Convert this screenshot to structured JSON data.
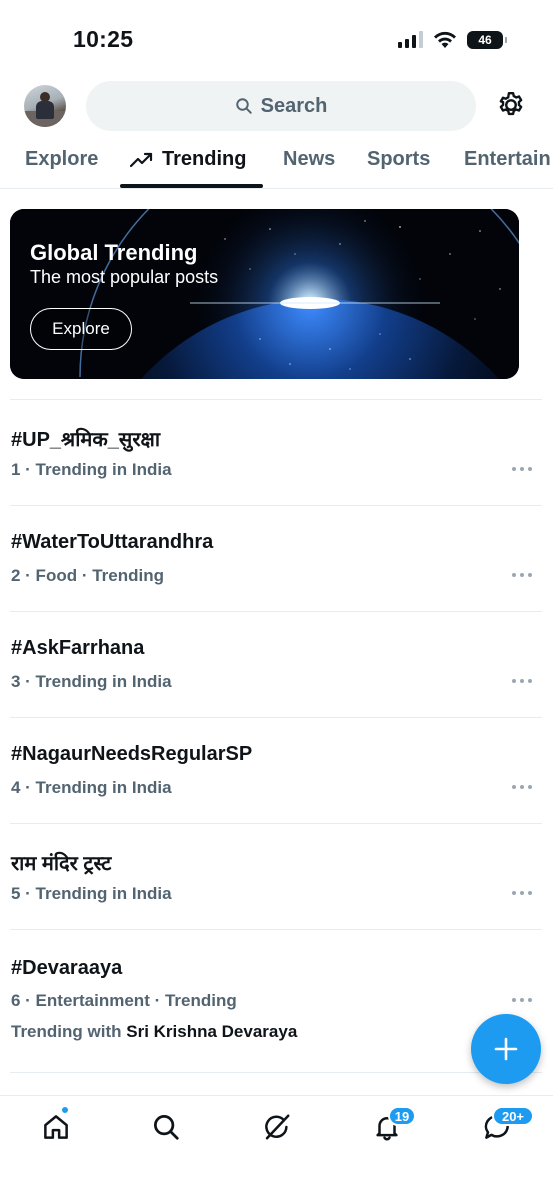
{
  "status_bar": {
    "time": "10:25",
    "battery": "46"
  },
  "header": {
    "search_label": "Search"
  },
  "tabs": [
    {
      "label": "Explore"
    },
    {
      "label": "Trending"
    },
    {
      "label": "News"
    },
    {
      "label": "Sports"
    },
    {
      "label": "Entertain"
    }
  ],
  "banner": {
    "title": "Global Trending",
    "subtitle": "The most popular posts",
    "button": "Explore"
  },
  "trends": [
    {
      "title": "#UP_श्रमिक_सुरक्षा",
      "meta": "1 · Trending in India"
    },
    {
      "title": "#WaterToUttarandhra",
      "meta": "2 · Food · Trending"
    },
    {
      "title": "#AskFarrhana",
      "meta": "3 · Trending in India"
    },
    {
      "title": "#NagaurNeedsRegularSP",
      "meta": "4 · Trending in India"
    },
    {
      "title": "राम मंदिर ट्रस्ट",
      "meta": "5 · Trending in India"
    },
    {
      "title": "#Devaraaya",
      "meta": "6 · Entertainment · Trending",
      "with_prefix": "Trending with",
      "with_name": "Sri Krishna Devaraya"
    }
  ],
  "bottom_nav": {
    "notifications_badge": "19",
    "messages_badge": "20+"
  },
  "colors": {
    "accent": "#1d9bf0",
    "text_primary": "#0f1419",
    "text_secondary": "#536471",
    "search_bg": "#eff3f4",
    "divider": "#e6ecf0"
  },
  "icons": [
    "search-icon",
    "gear-icon",
    "trending-arrow-icon",
    "more-icon",
    "plus-icon",
    "home-icon",
    "grok-icon",
    "bell-icon",
    "messages-icon"
  ]
}
